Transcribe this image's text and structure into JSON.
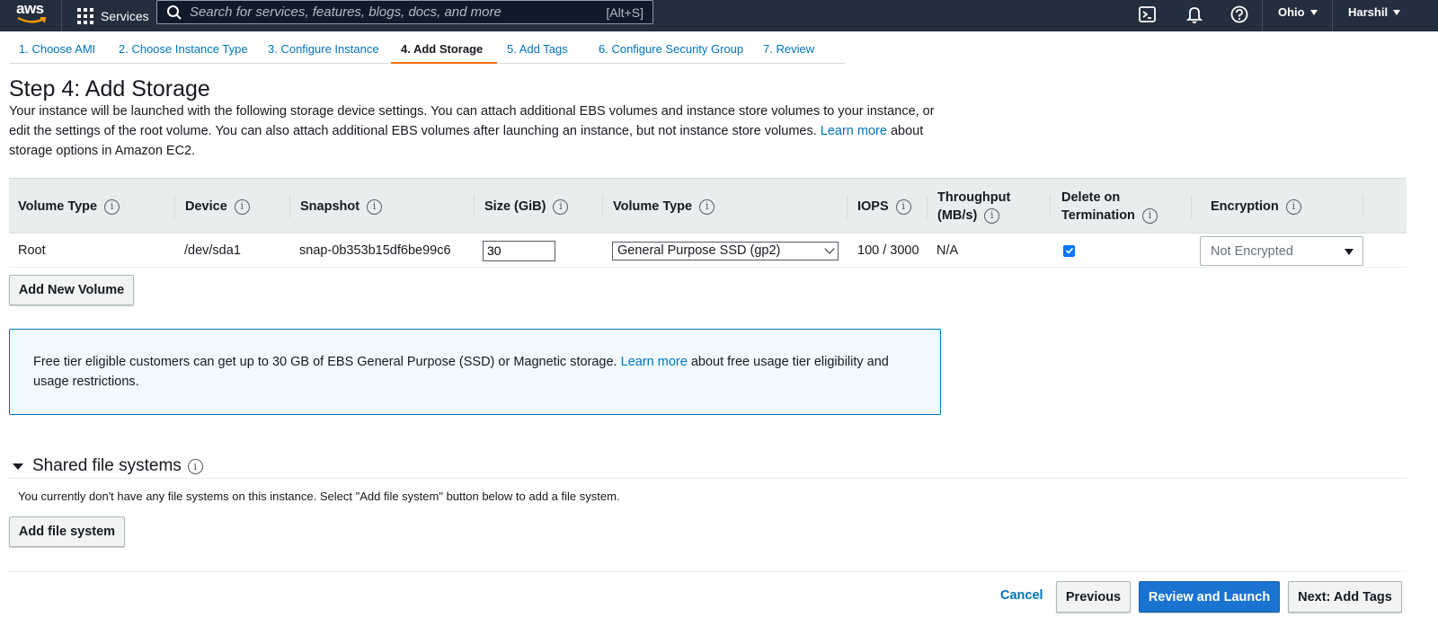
{
  "topnav": {
    "logo_text": "aws",
    "services_label": "Services",
    "search_placeholder": "Search for services, features, blogs, docs, and more",
    "search_shortcut": "[Alt+S]",
    "region": "Ohio",
    "user": "Harshil"
  },
  "tabs": [
    {
      "label": "1. Choose AMI"
    },
    {
      "label": "2. Choose Instance Type"
    },
    {
      "label": "3. Configure Instance"
    },
    {
      "label": "4. Add Storage"
    },
    {
      "label": "5. Add Tags"
    },
    {
      "label": "6. Configure Security Group"
    },
    {
      "label": "7. Review"
    }
  ],
  "page": {
    "title": "Step 4: Add Storage",
    "desc_before": "Your instance will be launched with the following storage device settings. You can attach additional EBS volumes and instance store volumes to your instance, or edit the settings of the root volume. You can also attach additional EBS volumes after launching an instance, but not instance store volumes.",
    "desc_link": "Learn more",
    "desc_after": "about storage options in Amazon EC2."
  },
  "table": {
    "headers": {
      "volume_type": "Volume Type",
      "device": "Device",
      "snapshot": "Snapshot",
      "size": "Size (GiB)",
      "vol_type2": "Volume Type",
      "iops": "IOPS",
      "throughput_line1": "Throughput",
      "throughput_line2": "(MB/s)",
      "delete_line1": "Delete on",
      "delete_line2": "Termination",
      "encryption": "Encryption"
    },
    "row": {
      "volume_type": "Root",
      "device": "/dev/sda1",
      "snapshot": "snap-0b353b15df6be99c6",
      "size": "30",
      "vol_type_selected": "General Purpose SSD (gp2)",
      "iops": "100 / 3000",
      "throughput": "N/A",
      "delete_on_termination": true,
      "encryption": "Not Encrypted"
    },
    "add_volume_label": "Add New Volume"
  },
  "info_box": {
    "text_before": "Free tier eligible customers can get up to 30 GB of EBS General Purpose (SSD) or Magnetic storage.",
    "link": "Learn more",
    "text_after": "about free usage tier eligibility and usage restrictions."
  },
  "shared_fs": {
    "title": "Shared file systems",
    "desc": "You currently don't have any file systems on this instance. Select \"Add file system\" button below to add a file system.",
    "add_label": "Add file system"
  },
  "footer": {
    "cancel": "Cancel",
    "previous": "Previous",
    "review_launch": "Review and Launch",
    "next": "Next: Add Tags"
  },
  "colors": {
    "nav_bg": "#232f3e",
    "link": "#0073bb",
    "active_tab_underline": "#ec7211",
    "primary_button": "#1a73d0"
  }
}
